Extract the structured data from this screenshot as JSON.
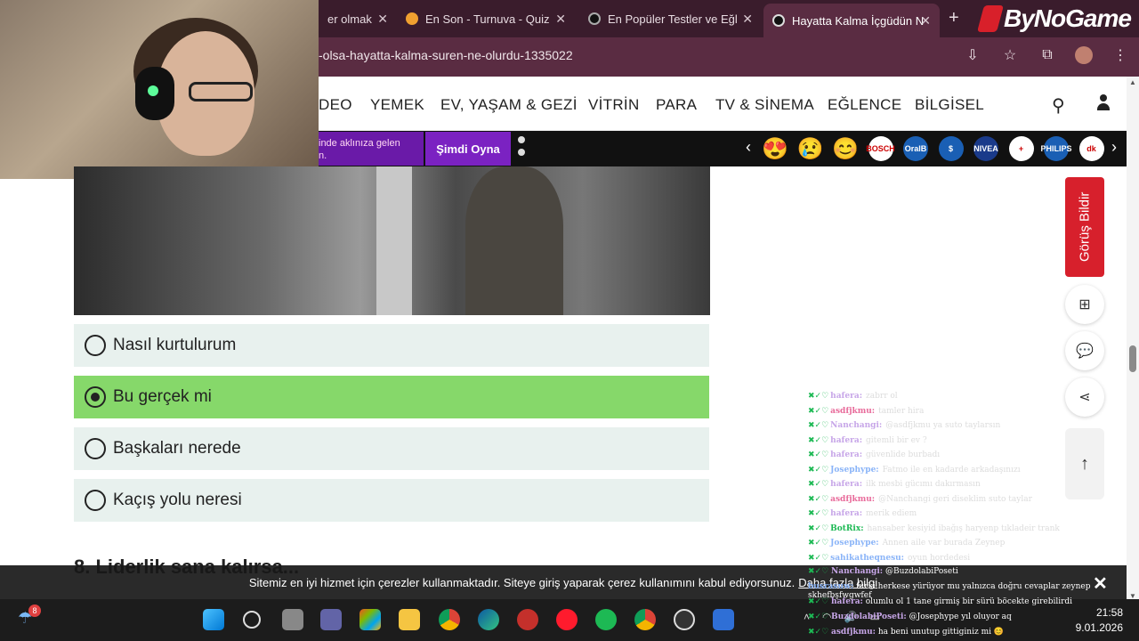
{
  "browser": {
    "tabs": [
      {
        "title": "er olmak"
      },
      {
        "title": "En Son - Turnuva - Quiz"
      },
      {
        "title": "En Popüler Testler ve Eğl"
      },
      {
        "title": "Hayatta Kalma İçgüdün N"
      }
    ],
    "brand_logo_text": "ByNoGame",
    "url": "-olsa-hayatta-kalma-suren-ne-olurdu-1335022"
  },
  "site_nav": {
    "items": [
      "DEO",
      "YEMEK",
      "EV, YAŞAM & GEZİ",
      "VİTRİN",
      "PARA",
      "TV & SİNEMA",
      "EĞLENCE",
      "BİLGİSEL"
    ]
  },
  "promo": {
    "text_line1": "inde aklınıza gelen",
    "text_line2": "n.",
    "play_label": "Şimdi Oyna"
  },
  "reactions": [
    {
      "icon": "heart-eyes-emoji-icon",
      "label": "😍",
      "color": "#f5c518"
    },
    {
      "icon": "sad-emoji-icon",
      "label": "😢",
      "color": "#f5c518"
    },
    {
      "icon": "smile-emoji-icon",
      "label": "😊",
      "color": "#f5c518"
    },
    {
      "icon": "bosch-icon",
      "label": "BOSCH",
      "color": "#ffffff"
    },
    {
      "icon": "oralb-icon",
      "label": "OralB",
      "color": "#1a5fb4"
    },
    {
      "icon": "dollar-icon",
      "label": "$",
      "color": "#1a5fb4"
    },
    {
      "icon": "nivea-icon",
      "label": "NIVEA",
      "color": "#1a3a8a"
    },
    {
      "icon": "cross-icon",
      "label": "+",
      "color": "#ffffff"
    },
    {
      "icon": "philips-icon",
      "label": "PHILIPS",
      "color": "#1a5fb4"
    },
    {
      "icon": "dk-icon",
      "label": "dk",
      "color": "#ffffff"
    }
  ],
  "quiz": {
    "options": [
      {
        "label": "Nasıl kurtulurum",
        "selected": false
      },
      {
        "label": "Bu gerçek mi",
        "selected": true
      },
      {
        "label": "Başkaları nerede",
        "selected": false
      },
      {
        "label": "Kaçış yolu neresi",
        "selected": false
      }
    ],
    "next_question": "8. Liderlik sana kalırsa..."
  },
  "side_buttons": {
    "feedback": "Görüş Bildir"
  },
  "chat": [
    {
      "user": "hafera:",
      "user_color": "#c7a6e8",
      "msg": "zabrr ol"
    },
    {
      "user": "asdfjkmu:",
      "user_color": "#e86a9a",
      "msg": "tamler hira"
    },
    {
      "user": "Nanchangi:",
      "user_color": "#c7a6e8",
      "msg": "@asdfjkmu ya suto taylarsın"
    },
    {
      "user": "hafera:",
      "user_color": "#c7a6e8",
      "msg": "gitemli bir ev ?"
    },
    {
      "user": "hafera:",
      "user_color": "#c7a6e8",
      "msg": "güvenlide burbadı"
    },
    {
      "user": "Josephype:",
      "user_color": "#8ab4f8",
      "msg": "Fatmo ile en kadarde arkadaşınızı"
    },
    {
      "user": "hafera:",
      "user_color": "#c7a6e8",
      "msg": "ilk mesbi gücımı dakırmasın"
    },
    {
      "user": "asdfjkmu:",
      "user_color": "#e86a9a",
      "msg": "@Nanchangi geri diseklim suto taylar"
    },
    {
      "user": "hafera:",
      "user_color": "#c7a6e8",
      "msg": "merik ediem"
    },
    {
      "user": "BotRix:",
      "user_color": "#1db954",
      "msg": "hansaber kesiyid ibağış haryenp tıkladeir trank"
    },
    {
      "user": "Josephype:",
      "user_color": "#8ab4f8",
      "msg": "Annen aile var burada Zeynep"
    },
    {
      "user": "sahikatheqnesu:",
      "user_color": "#8ab4f8",
      "msg": "oyun hordedesi"
    }
  ],
  "cookie_bar": {
    "text": "Sitemiz en iyi hizmet için çerezler kullanmaktadır. Siteye giriş yaparak çerez kullanımını kabul ediyorsunuz.",
    "link": "Daha fazla bilgi",
    "chat1_user": "Nanchangi:",
    "chat1_msg": "@BuzdolabiPoseti",
    "chat2_user": "busrasuw:",
    "chat2_msg": "furki herkese yürüyor mu yalnızca doğru cevaplar zeynep skhefbşfwgwfef"
  },
  "taskbar_chat": [
    {
      "user": "hafera:",
      "msg": "olumlu ol 1 tane girmiş bir sürü böcekte girebilirdi"
    },
    {
      "user": "BuzdolabiPoseti:",
      "msg": "@Josephype yıl oluyor aq"
    },
    {
      "user": "asdfjkmu:",
      "msg": "ha beni unutup gittiginiz mi 😊"
    }
  ],
  "taskbar": {
    "weather_badge": "8",
    "time": "21:58",
    "date": "9.01.2026"
  }
}
